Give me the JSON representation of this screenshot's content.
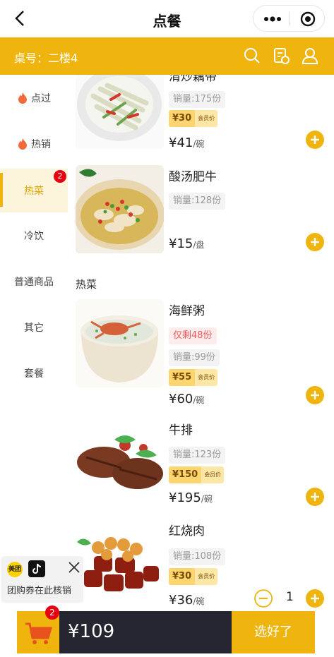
{
  "nav": {
    "title": "点餐"
  },
  "header": {
    "table_label": "桌号：二楼4"
  },
  "sidebar": {
    "categories": [
      {
        "label": "点过"
      },
      {
        "label": "热销"
      },
      {
        "label": "热菜",
        "badge": "2"
      },
      {
        "label": "冷饮"
      },
      {
        "label": "普通商品"
      },
      {
        "label": "其它"
      },
      {
        "label": "套餐"
      }
    ]
  },
  "content": {
    "section_title": "热菜",
    "items": [
      {
        "name": "清炒藕带",
        "sales": "销量:175份",
        "member_price": "¥30",
        "member_label": "会员价",
        "price": "¥41",
        "unit": "/碗"
      },
      {
        "name": "酸汤肥牛",
        "sales": "销量:128份",
        "price": "¥15",
        "unit": "/盘"
      },
      {
        "name": "海鲜粥",
        "stock": "仅剩48份",
        "sales": "销量:99份",
        "member_price": "¥55",
        "member_label": "会员价",
        "price": "¥60",
        "unit": "/碗"
      },
      {
        "name": "牛排",
        "sales": "销量:123份",
        "member_price": "¥150",
        "member_label": "会员价",
        "price": "¥195",
        "unit": "/碗"
      },
      {
        "name": "红烧肉",
        "sales": "销量:108份",
        "member_price": "¥30",
        "member_label": "会员价",
        "price": "¥36",
        "unit": "/碗",
        "quantity": "1"
      }
    ]
  },
  "coupon": {
    "meituan_logo": "美团",
    "text": "团购券在此核销"
  },
  "cart": {
    "badge": "2",
    "total": "¥109",
    "checkout_label": "选好了"
  },
  "colors": {
    "accent": "#f0b40e",
    "dark": "#252631",
    "badge": "#e60012"
  }
}
